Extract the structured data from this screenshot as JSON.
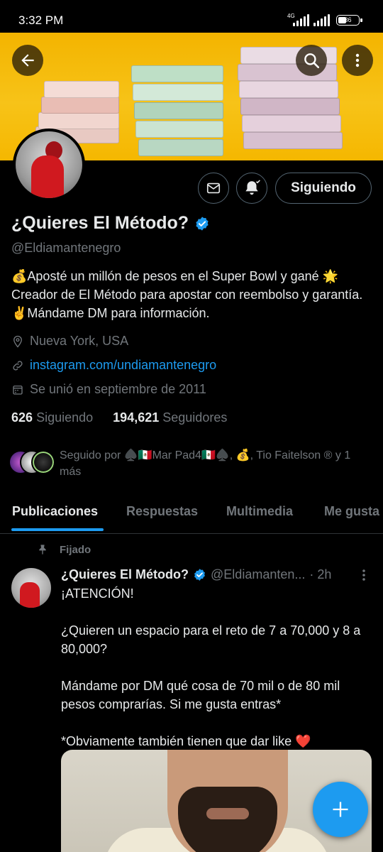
{
  "status_bar": {
    "time": "3:32 PM",
    "network": "4G",
    "battery": "36"
  },
  "header": {
    "back_icon": "arrow-left-icon",
    "search_icon": "search-icon",
    "more_icon": "more-vertical-icon"
  },
  "profile": {
    "name": "¿Quieres El Método?",
    "handle": "@Eldiamantenegro",
    "bio": "💰Aposté un millón de pesos en el Super Bowl y gané 🌟 Creador de El Método para apostar con reembolso y garantía. ✌️Mándame DM para información.",
    "location": "Nueva York, USA",
    "website": "instagram.com/undiamantenegro",
    "joined": "Se unió en septiembre de 2011",
    "following_count": "626",
    "following_label": "Siguiendo",
    "followers_count": "194,621",
    "followers_label": "Seguidores",
    "follow_button": "Siguiendo",
    "followed_by": "Seguido por ♠️🇲🇽Mar Pad4🇲🇽♠️, 💰, Tio Faitelson ® y 1 más",
    "accent": "#1d9bf0"
  },
  "tabs": [
    "Publicaciones",
    "Respuestas",
    "Multimedia",
    "Me gusta"
  ],
  "post": {
    "pinned_label": "Fijado",
    "author": "¿Quieres El Método?",
    "handle": "@Eldiamanten...",
    "time": "· 2h",
    "line1": "¡ATENCIÓN!",
    "line2": "¿Quieren un espacio para el reto de 7 a 70,000 y 8 a 80,000?",
    "line3": "Mándame por DM qué cosa de 70 mil o de 80 mil pesos comprarías. Si me gusta entras*",
    "line4": "*Obviamente también tienen que dar like ❤️"
  },
  "fab_icon": "plus-icon"
}
